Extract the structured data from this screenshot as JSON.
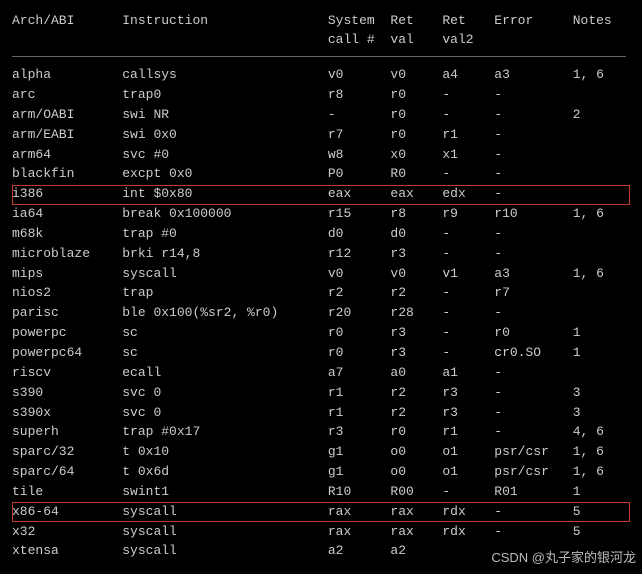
{
  "headers": {
    "arch": "Arch/ABI",
    "instr": "Instruction",
    "sysnum_l1": "System",
    "sysnum_l2": "call #",
    "ret_l1": "Ret",
    "ret_l2": "val",
    "ret2_l1": "Ret",
    "ret2_l2": "val2",
    "err": "Error",
    "notes": "Notes"
  },
  "rows": [
    {
      "arch": "alpha",
      "instr": "callsys",
      "sysnum": "v0",
      "ret": "v0",
      "ret2": "a4",
      "err": "a3",
      "notes": "1, 6",
      "hl": false
    },
    {
      "arch": "arc",
      "instr": "trap0",
      "sysnum": "r8",
      "ret": "r0",
      "ret2": "-",
      "err": "-",
      "notes": "",
      "hl": false
    },
    {
      "arch": "arm/OABI",
      "instr": "swi NR",
      "sysnum": "-",
      "ret": "r0",
      "ret2": "-",
      "err": "-",
      "notes": "2",
      "hl": false
    },
    {
      "arch": "arm/EABI",
      "instr": "swi 0x0",
      "sysnum": "r7",
      "ret": "r0",
      "ret2": "r1",
      "err": "-",
      "notes": "",
      "hl": false
    },
    {
      "arch": "arm64",
      "instr": "svc #0",
      "sysnum": "w8",
      "ret": "x0",
      "ret2": "x1",
      "err": "-",
      "notes": "",
      "hl": false
    },
    {
      "arch": "blackfin",
      "instr": "excpt 0x0",
      "sysnum": "P0",
      "ret": "R0",
      "ret2": "-",
      "err": "-",
      "notes": "",
      "hl": false
    },
    {
      "arch": "i386",
      "instr": "int $0x80",
      "sysnum": "eax",
      "ret": "eax",
      "ret2": "edx",
      "err": "-",
      "notes": "",
      "hl": true
    },
    {
      "arch": "ia64",
      "instr": "break 0x100000",
      "sysnum": "r15",
      "ret": "r8",
      "ret2": "r9",
      "err": "r10",
      "notes": "1, 6",
      "hl": false
    },
    {
      "arch": "m68k",
      "instr": "trap #0",
      "sysnum": "d0",
      "ret": "d0",
      "ret2": "-",
      "err": "-",
      "notes": "",
      "hl": false
    },
    {
      "arch": "microblaze",
      "instr": "brki r14,8",
      "sysnum": "r12",
      "ret": "r3",
      "ret2": "-",
      "err": "-",
      "notes": "",
      "hl": false
    },
    {
      "arch": "mips",
      "instr": "syscall",
      "sysnum": "v0",
      "ret": "v0",
      "ret2": "v1",
      "err": "a3",
      "notes": "1, 6",
      "hl": false
    },
    {
      "arch": "nios2",
      "instr": "trap",
      "sysnum": "r2",
      "ret": "r2",
      "ret2": "-",
      "err": "r7",
      "notes": "",
      "hl": false
    },
    {
      "arch": "parisc",
      "instr": "ble 0x100(%sr2, %r0)",
      "sysnum": "r20",
      "ret": "r28",
      "ret2": "-",
      "err": "-",
      "notes": "",
      "hl": false
    },
    {
      "arch": "powerpc",
      "instr": "sc",
      "sysnum": "r0",
      "ret": "r3",
      "ret2": "-",
      "err": "r0",
      "notes": "1",
      "hl": false
    },
    {
      "arch": "powerpc64",
      "instr": "sc",
      "sysnum": "r0",
      "ret": "r3",
      "ret2": "-",
      "err": "cr0.SO",
      "notes": "1",
      "hl": false
    },
    {
      "arch": "riscv",
      "instr": "ecall",
      "sysnum": "a7",
      "ret": "a0",
      "ret2": "a1",
      "err": "-",
      "notes": "",
      "hl": false
    },
    {
      "arch": "s390",
      "instr": "svc 0",
      "sysnum": "r1",
      "ret": "r2",
      "ret2": "r3",
      "err": "-",
      "notes": "3",
      "hl": false
    },
    {
      "arch": "s390x",
      "instr": "svc 0",
      "sysnum": "r1",
      "ret": "r2",
      "ret2": "r3",
      "err": "-",
      "notes": "3",
      "hl": false
    },
    {
      "arch": "superh",
      "instr": "trap #0x17",
      "sysnum": "r3",
      "ret": "r0",
      "ret2": "r1",
      "err": "-",
      "notes": "4, 6",
      "hl": false
    },
    {
      "arch": "sparc/32",
      "instr": "t 0x10",
      "sysnum": "g1",
      "ret": "o0",
      "ret2": "o1",
      "err": "psr/csr",
      "notes": "1, 6",
      "hl": false
    },
    {
      "arch": "sparc/64",
      "instr": "t 0x6d",
      "sysnum": "g1",
      "ret": "o0",
      "ret2": "o1",
      "err": "psr/csr",
      "notes": "1, 6",
      "hl": false
    },
    {
      "arch": "tile",
      "instr": "swint1",
      "sysnum": "R10",
      "ret": "R00",
      "ret2": "-",
      "err": "R01",
      "notes": "1",
      "hl": false
    },
    {
      "arch": "x86-64",
      "instr": "syscall",
      "sysnum": "rax",
      "ret": "rax",
      "ret2": "rdx",
      "err": "-",
      "notes": "5",
      "hl": true
    },
    {
      "arch": "x32",
      "instr": "syscall",
      "sysnum": "rax",
      "ret": "rax",
      "ret2": "rdx",
      "err": "-",
      "notes": "5",
      "hl": false
    },
    {
      "arch": "xtensa",
      "instr": "syscall",
      "sysnum": "a2",
      "ret": "a2",
      "ret2": "",
      "err": "",
      "notes": "",
      "hl": false
    }
  ],
  "watermark": "CSDN @丸子家的银河龙"
}
